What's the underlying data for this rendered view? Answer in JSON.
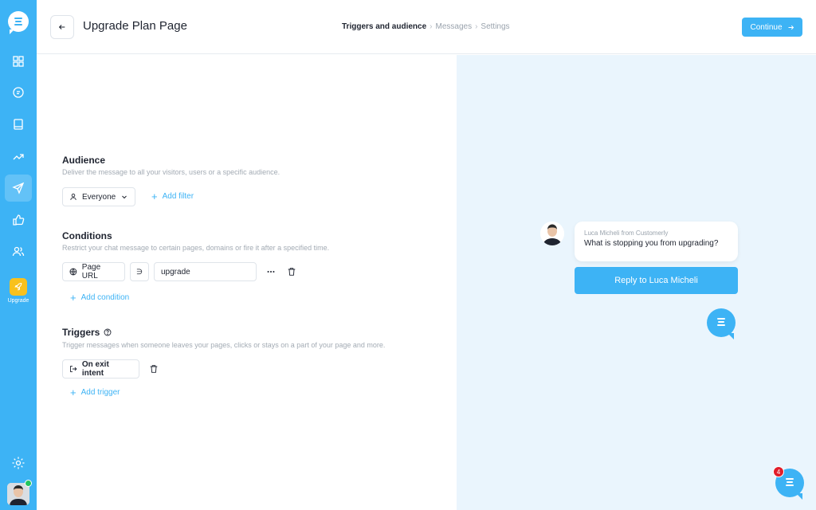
{
  "header": {
    "title": "Upgrade Plan Page",
    "steps": [
      "Triggers and audience",
      "Messages",
      "Settings"
    ],
    "continue_label": "Continue"
  },
  "sidebar": {
    "items": [
      {
        "name": "dashboard",
        "icon": "grid-icon"
      },
      {
        "name": "conversations",
        "icon": "chat-icon"
      },
      {
        "name": "knowledge-base",
        "icon": "book-icon"
      },
      {
        "name": "reports",
        "icon": "trend-icon"
      },
      {
        "name": "outbound",
        "icon": "send-icon",
        "active": true
      },
      {
        "name": "feedback",
        "icon": "thumbs-up-icon"
      },
      {
        "name": "contacts",
        "icon": "users-icon"
      }
    ],
    "upgrade_label": "Upgrade"
  },
  "audience": {
    "title": "Audience",
    "description": "Deliver the message to all your visitors, users or a specific audience.",
    "selected": "Everyone",
    "add_filter": "Add filter"
  },
  "conditions": {
    "title": "Conditions",
    "description": "Restrict your chat message to certain pages, domains or fire it after a specified time.",
    "field": "Page URL",
    "operator": "∋",
    "value": "upgrade",
    "add_condition": "Add condition"
  },
  "triggers": {
    "title": "Triggers",
    "description": "Trigger messages when someone leaves your pages, clicks or stays on a part of your page and more.",
    "trigger": "On exit intent",
    "add_trigger": "Add trigger"
  },
  "preview": {
    "from": "Luca Micheli from Customerly",
    "message": "What is stopping you from upgrading?",
    "reply_label": "Reply to Luca Micheli"
  },
  "launcher": {
    "badge_count": "4"
  },
  "colors": {
    "brand": "#3db3f5",
    "upgrade": "#f8c11e",
    "badge": "#e11d2a",
    "online": "#22c55e"
  }
}
